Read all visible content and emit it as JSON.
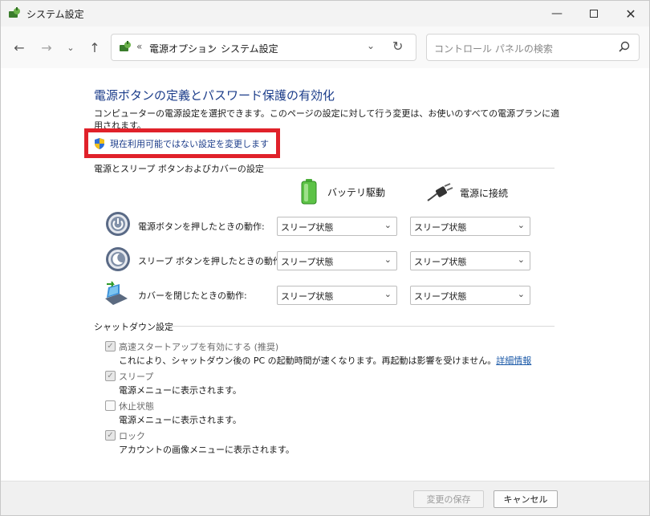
{
  "window": {
    "title": "システム設定",
    "icons": {
      "app": "power-options-icon"
    }
  },
  "nav": {
    "address": {
      "segments": [
        "電源オプション",
        "システム設定"
      ],
      "overflow": "«"
    },
    "search": {
      "placeholder": "コントロール パネルの検索"
    }
  },
  "page": {
    "title": "電源ボタンの定義とパスワード保護の有効化",
    "description": "コンピューターの電源設定を選択できます。このページの設定に対して行う変更は、お使いのすべての電源プランに適用されます。",
    "change_link": "現在利用可能ではない設定を変更します"
  },
  "power_section": {
    "title": "電源とスリープ ボタンおよびカバーの設定",
    "columns": [
      "バッテリ駆動",
      "電源に接続"
    ],
    "rows": [
      {
        "label": "電源ボタンを押したときの動作:",
        "battery": "スリープ状態",
        "plugged": "スリープ状態",
        "icon": "power-button-icon"
      },
      {
        "label": "スリープ ボタンを押したときの動作:",
        "battery": "スリープ状態",
        "plugged": "スリープ状態",
        "icon": "sleep-button-icon"
      },
      {
        "label": "カバーを閉じたときの動作:",
        "battery": "スリープ状態",
        "plugged": "スリープ状態",
        "icon": "laptop-lid-icon"
      }
    ]
  },
  "shutdown_section": {
    "title": "シャットダウン設定",
    "items": [
      {
        "label": "高速スタートアップを有効にする (推奨)",
        "desc": "これにより、シャットダウン後の PC の起動時間が速くなります。再起動は影響を受けません。",
        "link": "詳細情報",
        "checked": true
      },
      {
        "label": "スリープ",
        "desc": "電源メニューに表示されます。",
        "checked": true
      },
      {
        "label": "休止状態",
        "desc": "電源メニューに表示されます。",
        "checked": false
      },
      {
        "label": "ロック",
        "desc": "アカウントの画像メニューに表示されます。",
        "checked": true
      }
    ]
  },
  "footer": {
    "save": "変更の保存",
    "cancel": "キャンセル"
  },
  "colors": {
    "title_blue": "#1c3d8a",
    "highlight_red": "#e0212a",
    "link_blue": "#1c5aa8"
  }
}
